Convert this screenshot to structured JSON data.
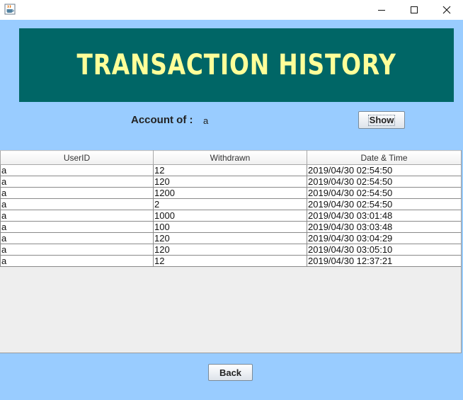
{
  "window": {
    "icons": {
      "app": "java-coffee-icon",
      "minimize": "minimize-icon",
      "maximize": "maximize-icon",
      "close": "close-icon"
    }
  },
  "banner": {
    "title": "TRANSACTION HISTORY"
  },
  "account": {
    "label": "Account of :",
    "value": "a"
  },
  "buttons": {
    "show": "Show",
    "back": "Back"
  },
  "table": {
    "columns": [
      "UserID",
      "Withdrawn",
      "Date & Time"
    ],
    "rows": [
      [
        "a",
        "12",
        "2019/04/30 02:54:50"
      ],
      [
        "a",
        "120",
        "2019/04/30 02:54:50"
      ],
      [
        "a",
        "1200",
        "2019/04/30 02:54:50"
      ],
      [
        "a",
        "2",
        "2019/04/30 02:54:50"
      ],
      [
        "a",
        "1000",
        "2019/04/30 03:01:48"
      ],
      [
        "a",
        "100",
        "2019/04/30 03:03:48"
      ],
      [
        "a",
        "120",
        "2019/04/30 03:04:29"
      ],
      [
        "a",
        "120",
        "2019/04/30 03:05:10"
      ],
      [
        "a",
        "12",
        "2019/04/30 12:37:21"
      ]
    ]
  },
  "colors": {
    "background": "#99ccff",
    "banner": "#006666",
    "banner_text": "#ffff99"
  }
}
